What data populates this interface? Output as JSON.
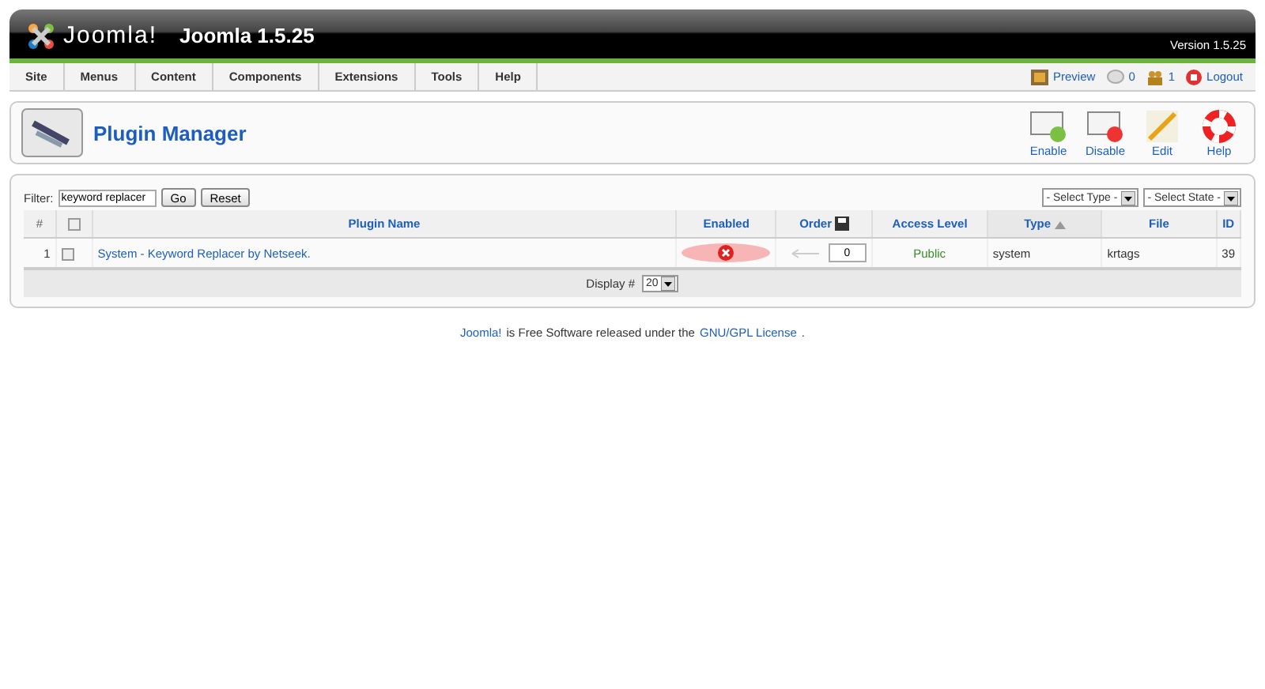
{
  "header": {
    "logo_text": "Joomla!",
    "title": "Joomla 1.5.25",
    "version": "Version 1.5.25"
  },
  "menu": [
    {
      "label": "Site"
    },
    {
      "label": "Menus"
    },
    {
      "label": "Content"
    },
    {
      "label": "Components"
    },
    {
      "label": "Extensions"
    },
    {
      "label": "Tools"
    },
    {
      "label": "Help"
    }
  ],
  "status": [
    {
      "kind": "preview",
      "label": "Preview"
    },
    {
      "kind": "messages",
      "label": "0"
    },
    {
      "kind": "users",
      "label": "1"
    },
    {
      "kind": "logout",
      "label": "Logout"
    }
  ],
  "toolbar": {
    "title": "Plugin Manager",
    "buttons": [
      {
        "kind": "enable",
        "label": "Enable"
      },
      {
        "kind": "disable",
        "label": "Disable"
      },
      {
        "kind": "edit",
        "label": "Edit"
      },
      {
        "kind": "help",
        "label": "Help"
      }
    ]
  },
  "filter": {
    "label": "Filter:",
    "value": "keyword replacer",
    "go": "Go",
    "reset": "Reset",
    "selects": [
      "- Select Type -",
      "- Select State -"
    ]
  },
  "table": {
    "columns": [
      {
        "label": "#",
        "kind": "num",
        "sorted": false
      },
      {
        "kind": "check",
        "sorted": false,
        "checked": false
      },
      {
        "label": "Plugin Name",
        "kind": "name",
        "sorted": false
      },
      {
        "label": "Enabled",
        "kind": "enabled",
        "sorted": false
      },
      {
        "label": "Order",
        "kind": "order",
        "sorted": false
      },
      {
        "label": "Access Level",
        "kind": "access",
        "sorted": false
      },
      {
        "label": "Type",
        "kind": "type",
        "sorted": true
      },
      {
        "label": "File",
        "kind": "file",
        "sorted": false
      },
      {
        "label": "ID",
        "kind": "id",
        "sorted": false
      }
    ],
    "rows": [
      {
        "num": "1",
        "checked": false,
        "name": "System - Keyword Replacer by Netseek.",
        "enabled": false,
        "highlighted": true,
        "order": "0",
        "access": "Public",
        "type": "system",
        "file": "krtags",
        "id": "39"
      }
    ],
    "display_label": "Display #",
    "display_value": "20"
  },
  "footer": {
    "link1": "Joomla!",
    "text": "is Free Software released under the",
    "link2": "GNU/GPL License",
    "end": "."
  }
}
